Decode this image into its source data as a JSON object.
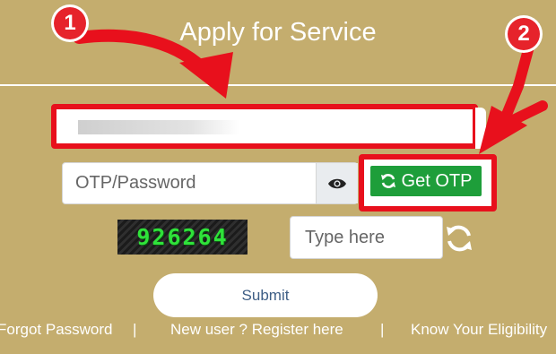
{
  "page": {
    "title": "Apply for Service"
  },
  "login": {
    "user_field_value": "",
    "password_placeholder": "OTP/Password",
    "get_otp_label": "Get OTP",
    "captcha_code": "926264",
    "captcha_placeholder": "Type here",
    "submit_label": "Submit"
  },
  "links": {
    "forgot": "Forgot Password",
    "sep1": "|",
    "register": "New user ? Register here",
    "sep2": "|",
    "eligibility": "Know Your Eligibility"
  },
  "annotations": {
    "badge_1": "1",
    "badge_2": "2",
    "highlight_color": "#e8101c"
  },
  "colors": {
    "background": "#c4ad6e",
    "otp_button": "#1e9e3a",
    "captcha_text": "#2fe23a"
  },
  "icons": {
    "password_toggle": "eye-icon",
    "otp": "refresh-icon",
    "captcha_refresh": "refresh-icon"
  }
}
